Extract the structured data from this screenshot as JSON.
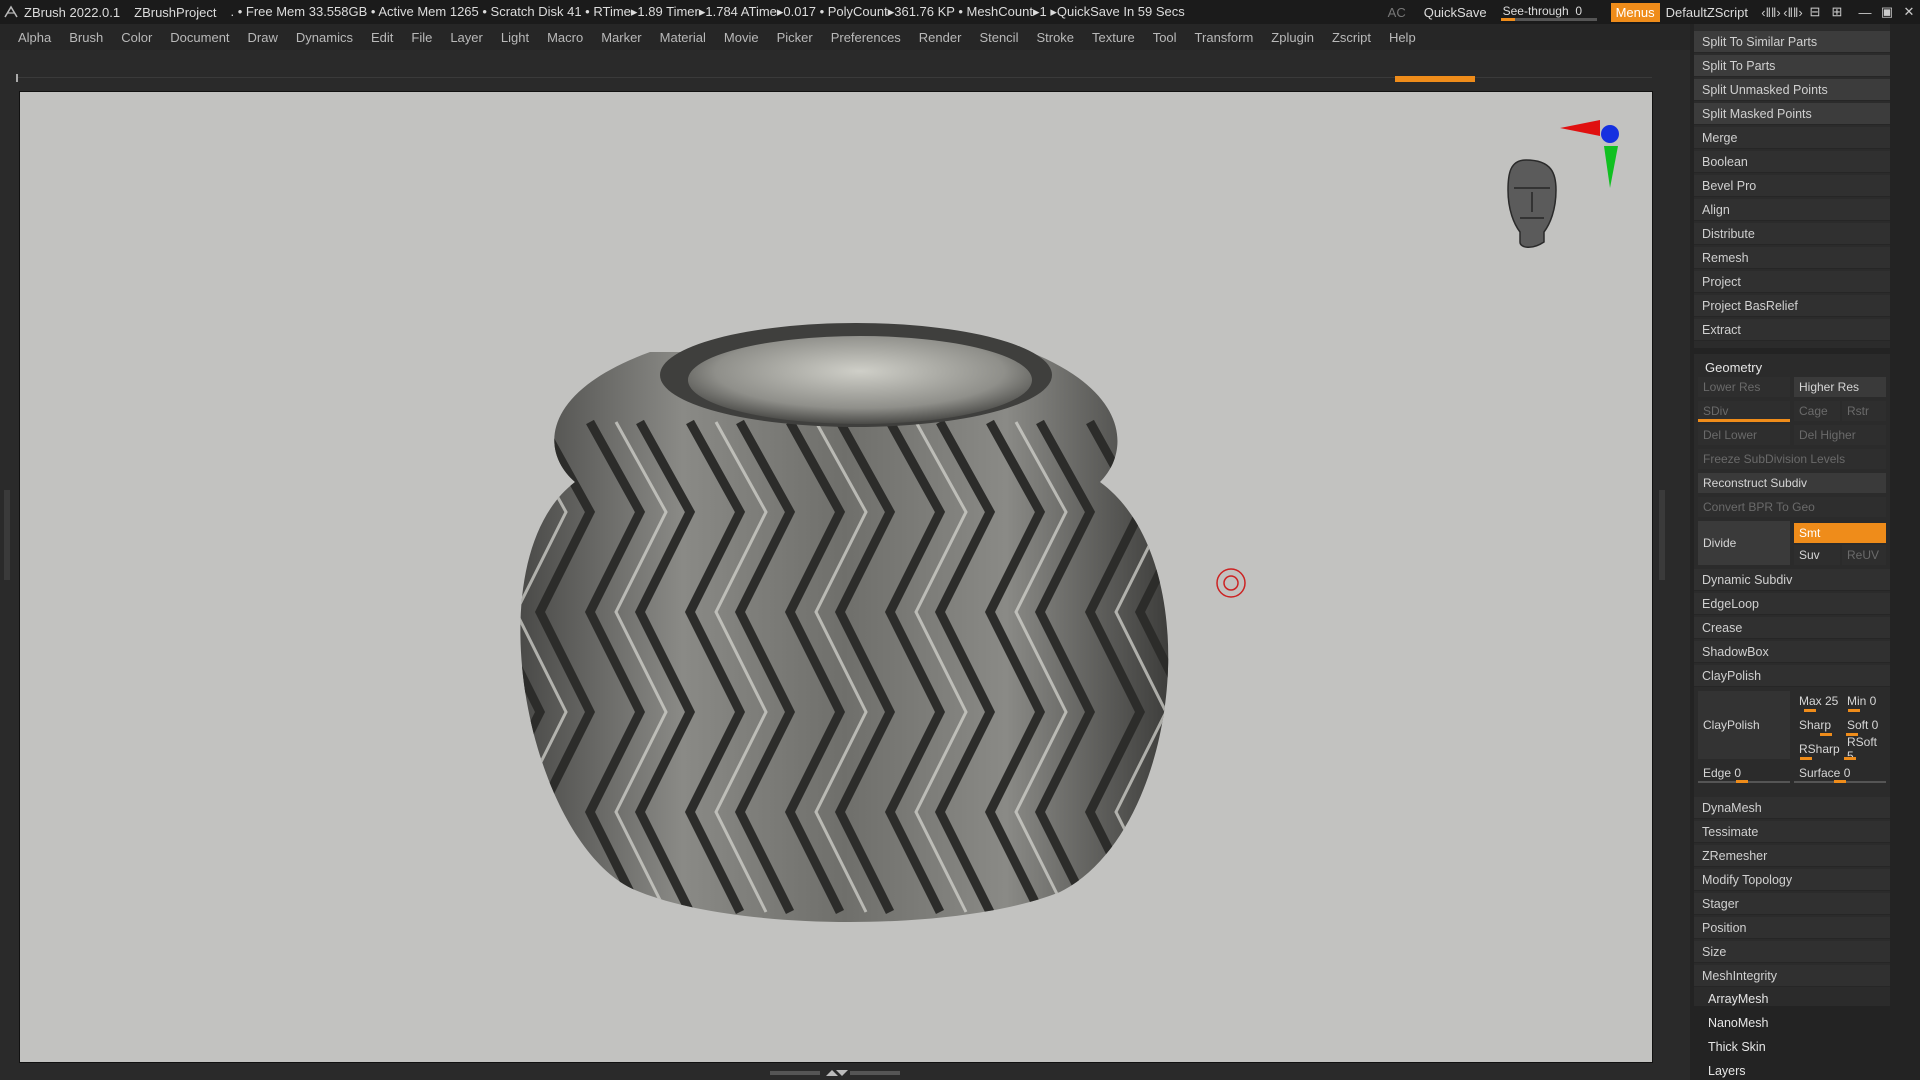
{
  "titlebar": {
    "app": "ZBrush 2022.0.1",
    "project": "ZBrushProject",
    "stats": ". • Free Mem 33.558GB • Active Mem 1265 • Scratch Disk 41 •  RTime▸1.89 Timer▸1.784 ATime▸0.017 • PolyCount▸361.76 KP  • MeshCount▸1   ▸QuickSave In 59 Secs",
    "ac": "AC",
    "quicksave": "QuickSave",
    "see_through_label": "See-through",
    "see_through_value": "0",
    "see_through_fraction": 0,
    "menus": "Menus",
    "script": "DefaultZScript",
    "window_icons": [
      "‹‖‖›",
      "‹‖‖›",
      "⊟",
      "⊞",
      "―",
      "▣",
      "✕"
    ]
  },
  "menubar": [
    "Alpha",
    "Brush",
    "Color",
    "Document",
    "Draw",
    "Dynamics",
    "Edit",
    "File",
    "Layer",
    "Light",
    "Macro",
    "Marker",
    "Material",
    "Movie",
    "Picker",
    "Preferences",
    "Render",
    "Stencil",
    "Stroke",
    "Texture",
    "Tool",
    "Transform",
    "Zplugin",
    "Zscript",
    "Help"
  ],
  "colors": {
    "accent": "#ef8c1a",
    "viewport_bg": "#c2c2c0",
    "panel_bg": "#232323"
  },
  "palette": {
    "subtool_buttons": [
      "Split To Similar Parts",
      "Split To Parts",
      "Split Unmasked Points",
      "Split Masked Points"
    ],
    "subtool_items": [
      "Merge",
      "Boolean",
      "Bevel Pro",
      "Align",
      "Distribute",
      "Remesh",
      "Project",
      "Project BasRelief",
      "Extract"
    ],
    "geometry": {
      "title": "Geometry",
      "lower_res": "Lower Res",
      "higher_res": "Higher Res",
      "sdiv": "SDiv",
      "cage": "Cage",
      "rstr": "Rstr",
      "del_lower": "Del Lower",
      "del_higher": "Del Higher",
      "freeze": "Freeze SubDivision Levels",
      "reconstruct": "Reconstruct Subdiv",
      "convert_bpr": "Convert BPR To Geo",
      "divide": "Divide",
      "smt": "Smt",
      "suv": "Suv",
      "reuv": "ReUV",
      "dynamic_subdiv": "Dynamic Subdiv",
      "edgeloop": "EdgeLoop",
      "crease": "Crease",
      "shadowbox": "ShadowBox",
      "claypolish_header": "ClayPolish",
      "claypolish_btn": "ClayPolish",
      "max": "Max 25",
      "min": "Min 0",
      "sharp": "Sharp",
      "soft": "Soft 0",
      "rsharp": "RSharp",
      "rsoft": "RSoft 5",
      "edge": "Edge 0",
      "surface": "Surface 0",
      "after_items": [
        "DynaMesh",
        "Tessimate",
        "ZRemesher",
        "Modify Topology",
        "Stager",
        "Position",
        "Size",
        "MeshIntegrity"
      ]
    },
    "bottom_items": [
      "ArrayMesh",
      "NanoMesh",
      "Thick Skin",
      "Layers"
    ]
  },
  "viewport": {
    "object": "ribbed-vase-mesh",
    "gizmo_axes": [
      "x-red",
      "y-green",
      "z-blue"
    ]
  }
}
